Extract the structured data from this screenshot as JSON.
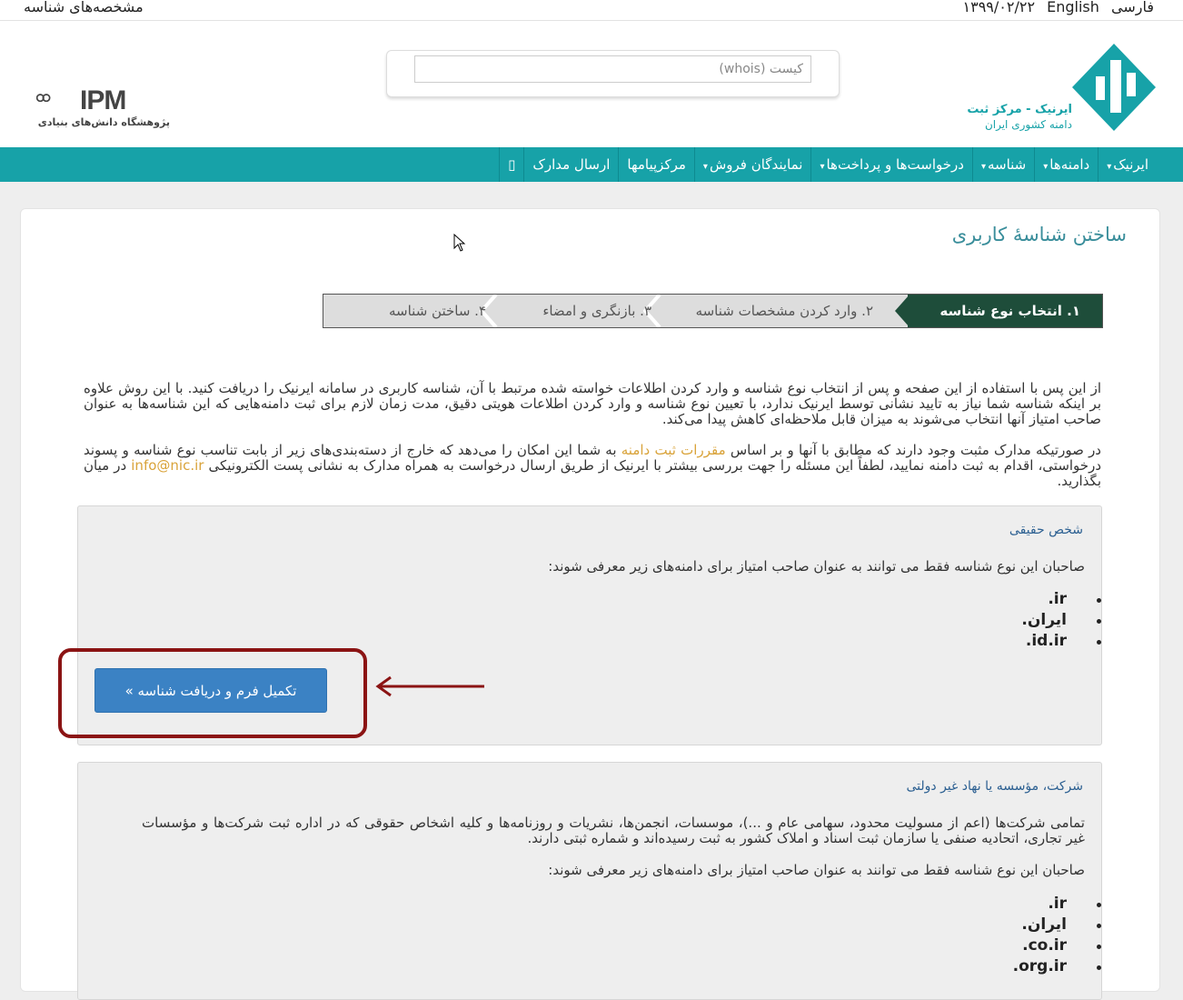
{
  "topbar": {
    "profile_link": "مشخصه‌های شناسه",
    "date": "۱۳۹۹/۰۲/۲۲",
    "lang_en": "English",
    "lang_fa": "فارسی"
  },
  "header": {
    "search_placeholder": "کیست (whois)",
    "ipm_text": "IPM",
    "ipm_subtitle": "پژوهشگاه دانش‌های بنیادی",
    "irnic_title": "ایرنیک - مرکز ثبت",
    "irnic_subtitle": "دامنه کشوری ایران"
  },
  "nav": {
    "items": [
      {
        "label": "ایرنیک",
        "dropdown": true
      },
      {
        "label": "دامنه‌ها",
        "dropdown": true
      },
      {
        "label": "شناسه",
        "dropdown": true
      },
      {
        "label": "درخواست‌ها و پرداخت‌ها",
        "dropdown": true
      },
      {
        "label": "نمایندگان فروش",
        "dropdown": true
      },
      {
        "label": "مرکزپیامها",
        "dropdown": false
      },
      {
        "label": "ارسال مدارک",
        "dropdown": false
      },
      {
        "label": "",
        "dropdown": false,
        "icon": "square-icon"
      }
    ]
  },
  "page": {
    "title": "ساختن شناسهٔ کاربری",
    "steps": [
      {
        "label": "۱.  انتخاب نوع شناسه"
      },
      {
        "label": "۲.  وارد کردن مشخصات شناسه"
      },
      {
        "label": "۳.  بازنگری و امضاء"
      },
      {
        "label": "۴.  ساختن شناسه"
      }
    ],
    "intro": "از این پس با استفاده از این صفحه و پس از انتخاب نوع شناسه و وارد کردن اطلاعات خواسته شده مرتبط با آن، شناسه کاربری در سامانه ایرنیک را دریافت کنید. با این روش علاوه بر اینکه شناسه شما نیاز به تایید نشانی توسط ایرنیک ندارد، با تعیین نوع شناسه و وارد کردن اطلاعات هویتی دقیق، مدت زمان لازم برای ثبت دامنه‌هایی که این شناسه‌ها به عنوان صاحب امتیاز آنها انتخاب می‌شوند به میزان قابل ملاحظه‌ای کاهش پیدا می‌کند.",
    "docs_part1": "در صورتیکه مدارک مثبت وجود دارند که مطابق با آنها و بر اساس ",
    "docs_link": "مقررات ثبت دامنه",
    "docs_part2": " به شما این امکان را می‌دهد که خارج از دسته‌بندی‌های زیر از بابت تناسب نوع شناسه و پسوند درخواستی، اقدام به ثبت دامنه نمایید، لطفاً این مسئله را جهت بررسی بیشتر با ایرنیک از طریق ارسال درخواست به همراه مدارک به نشانی پست الکترونیکی ",
    "docs_email": "info@nic.ir",
    "docs_part3": " در میان بگذارید."
  },
  "panel_person": {
    "title": "شخص حقیقی",
    "text": "صاحبان این نوع شناسه فقط می توانند به عنوان صاحب امتیاز برای دامنه‌های زیر معرفی شوند:",
    "domains": [
      ".ir",
      ".ایران",
      ".id.ir"
    ],
    "button": "تکمیل فرم و دریافت شناسه »"
  },
  "panel_company": {
    "title": "شرکت، مؤسسه یا نهاد غیر دولتی",
    "text1": "تمامی شرکت‌ها (اعم از مسولیت محدود، سهامی عام و ...)، موسسات، انجمن‌ها، نشریات و روزنامه‌ها و کلیه اشخاص حقوقی که در اداره ثبت شرکت‌ها و مؤسسات غیر تجاری، اتحادیه صنفی یا سازمان ثبت اسناد و املاک کشور به ثبت رسیده‌اند و شماره ثبتی دارند.",
    "text2": "صاحبان این نوع شناسه فقط می توانند به عنوان صاحب امتیاز برای دامنه‌های زیر معرفی شوند:",
    "domains": [
      ".ir",
      ".ایران",
      ".co.ir",
      ".org.ir"
    ]
  },
  "colors": {
    "nav_bg": "#17a2a8",
    "step_active": "#1e4d3a",
    "button": "#3b82c4",
    "highlight": "#8b1414",
    "link": "#d9a33a",
    "panel_title": "#2b5f91"
  }
}
